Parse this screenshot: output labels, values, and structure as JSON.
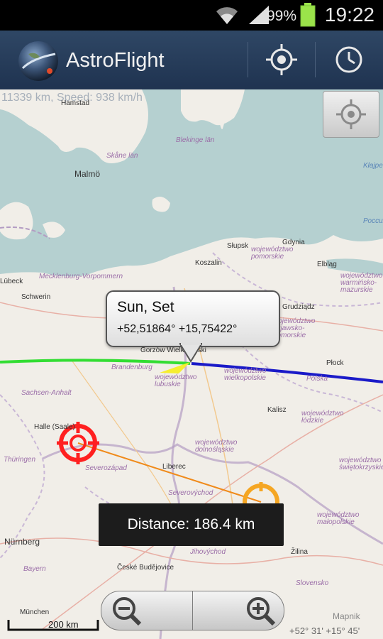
{
  "status_bar": {
    "battery_percent": "99%",
    "time": "19:22",
    "icons": [
      "wifi-icon",
      "signal-icon",
      "battery-icon"
    ]
  },
  "action_bar": {
    "title": "AstroFlight",
    "actions": [
      "locate-icon",
      "clock-icon"
    ]
  },
  "map": {
    "overlay_speed_text": "11339 km, Speed: 938 km/h",
    "place_labels": [
      "Hamstad",
      "Malmö",
      "Koszalin",
      "Słupsk",
      "Gdynia",
      "Elbląg",
      "Schwerin",
      "Lübeck",
      "Grudziądz",
      "Gorzów Wielkopolski",
      "Płock",
      "Kalisz",
      "Halle (Saale)",
      "Liberec",
      "Nürnberg",
      "České Budějovice",
      "Žilina",
      "München"
    ],
    "region_labels": [
      "Skåne län",
      "Blekinge län",
      "Mecklenburg-Vorpommern",
      "województwo pomorskie",
      "województwo warmińsko-mazurskie",
      "województwo kujawsko-pomorskie",
      "Brandenburg",
      "Polska",
      "województwo lubuskie",
      "województwo wielkopolskie",
      "Sachsen-Anhalt",
      "województwo łódzkie",
      "województwo dolnośląskie",
      "Severovýchod",
      "Severozápad",
      "województwo świętokrzyskie",
      "Thüringen",
      "województwo małopolskie",
      "Jihovýchod",
      "Bayern",
      "Slovensko",
      "Kłajpeda",
      "Россия"
    ],
    "sun_callout": {
      "title": "Sun, Set",
      "coords": "+52,51864°  +15,75422°"
    },
    "distance_toast": "Distance: 186.4 km",
    "scale_label": "200 km",
    "coord_readout": "+52° 31'  +15° 45'",
    "attribution": "Mapnik"
  },
  "colors": {
    "green_path": "#33dd33",
    "blue_path": "#1a1ac8",
    "orange_line": "#f08a1a",
    "red_target": "#ff2020",
    "orange_target": "#f5a623",
    "water": "#b5d0d0",
    "land": "#f1eee8",
    "action_bar": "#2a3f5c"
  }
}
